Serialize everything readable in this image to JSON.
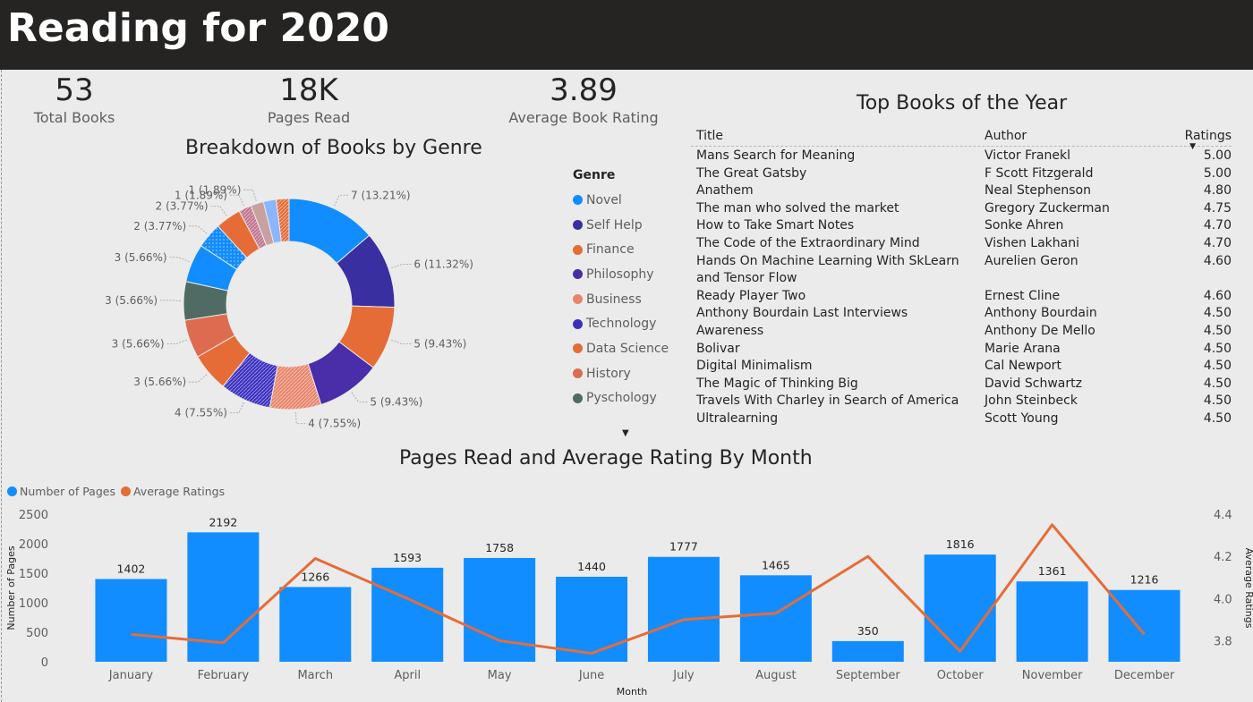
{
  "page": {
    "title": "Reading for 2020"
  },
  "kpis": [
    {
      "value": "53",
      "label": "Total Books"
    },
    {
      "value": "18K",
      "label": "Pages Read"
    },
    {
      "value": "3.89",
      "label": "Average Book Rating"
    }
  ],
  "colors": {
    "header_bg": "#252423",
    "bar": "#118dff",
    "line": "#e66c37",
    "background": "#ebebeb"
  },
  "table": {
    "title": "Top Books of the Year",
    "headers": {
      "title": "Title",
      "author": "Author",
      "ratings": "Ratings"
    },
    "rows": [
      {
        "title": "Mans Search for Meaning",
        "author": "Victor Franekl",
        "rating": "5.00"
      },
      {
        "title": "The Great Gatsby",
        "author": "F Scott Fitzgerald",
        "rating": "5.00"
      },
      {
        "title": "Anathem",
        "author": "Neal Stephenson",
        "rating": "4.80"
      },
      {
        "title": "The man who solved the market",
        "author": "Gregory Zuckerman",
        "rating": "4.75"
      },
      {
        "title": "How to Take Smart Notes",
        "author": "Sonke Ahren",
        "rating": "4.70"
      },
      {
        "title": "The Code of the Extraordinary Mind",
        "author": "Vishen Lakhani",
        "rating": "4.70"
      },
      {
        "title": "Hands On Machine Learning With SkLearn and Tensor Flow",
        "author": "Aurelien Geron",
        "rating": "4.60"
      },
      {
        "title": "Ready Player Two",
        "author": "Ernest Cline",
        "rating": "4.60"
      },
      {
        "title": "Anthony Bourdain Last Interviews",
        "author": "Anthony Bourdain",
        "rating": "4.50"
      },
      {
        "title": "Awareness",
        "author": "Anthony De Mello",
        "rating": "4.50"
      },
      {
        "title": "Bolivar",
        "author": "Marie Arana",
        "rating": "4.50"
      },
      {
        "title": "Digital Minimalism",
        "author": "Cal Newport",
        "rating": "4.50"
      },
      {
        "title": "The Magic of Thinking Big",
        "author": "David Schwartz",
        "rating": "4.50"
      },
      {
        "title": "Travels With Charley in Search of America",
        "author": "John Steinbeck",
        "rating": "4.50"
      },
      {
        "title": "Ultralearning",
        "author": "Scott Young",
        "rating": "4.50"
      }
    ]
  },
  "chart_data": [
    {
      "type": "pie",
      "title": "Breakdown of Books by Genre",
      "legend_title": "Genre",
      "legend_position": "right",
      "donut": true,
      "slices": [
        {
          "value": 7,
          "label": "7 (13.21%)",
          "color": "#118dff",
          "pattern": "solid"
        },
        {
          "value": 6,
          "label": "6 (11.32%)",
          "color": "#3a2fa0",
          "pattern": "solid"
        },
        {
          "value": 5,
          "label": "5 (9.43%)",
          "color": "#e66c37",
          "pattern": "solid"
        },
        {
          "value": 5,
          "label": "5 (9.43%)",
          "color": "#4a2da8",
          "pattern": "solid"
        },
        {
          "value": 4,
          "label": "4 (7.55%)",
          "color": "#e8856b",
          "pattern": "hatch"
        },
        {
          "value": 4,
          "label": "4 (7.55%)",
          "color": "#3a2fc0",
          "pattern": "hatch"
        },
        {
          "value": 3,
          "label": "3 (5.66%)",
          "color": "#e66c37",
          "pattern": "solid"
        },
        {
          "value": 3,
          "label": "3 (5.66%)",
          "color": "#dd6b50",
          "pattern": "solid"
        },
        {
          "value": 3,
          "label": "3 (5.66%)",
          "color": "#4f6b64",
          "pattern": "solid"
        },
        {
          "value": 3,
          "label": "3 (5.66%)",
          "color": "#118dff",
          "pattern": "solid"
        },
        {
          "value": 2,
          "label": "2 (3.77%)",
          "color": "#118dff",
          "pattern": "dots"
        },
        {
          "value": 2,
          "label": "2 (3.77%)",
          "color": "#e66c37",
          "pattern": "solid"
        },
        {
          "value": 1,
          "label": "1 (1.89%)",
          "color": "#c0748e",
          "pattern": "hatch"
        },
        {
          "value": 1,
          "label": "1 (1.89%)",
          "color": "#c8a0a0",
          "pattern": "solid"
        },
        {
          "value": 1,
          "label": "",
          "color": "#8ab6ff",
          "pattern": "solid"
        },
        {
          "value": 1,
          "label": "",
          "color": "#e66c37",
          "pattern": "hatch"
        }
      ],
      "legend": [
        {
          "name": "Novel",
          "color": "#118dff"
        },
        {
          "name": "Self Help",
          "color": "#3a2fa0"
        },
        {
          "name": "Finance",
          "color": "#e66c37"
        },
        {
          "name": "Philosophy",
          "color": "#4a2da8"
        },
        {
          "name": "Business",
          "color": "#e8856b"
        },
        {
          "name": "Technology",
          "color": "#3a2fc0"
        },
        {
          "name": "Data Science",
          "color": "#e66c37"
        },
        {
          "name": "History",
          "color": "#dd6b50"
        },
        {
          "name": "Pyschology",
          "color": "#4f6b64"
        }
      ]
    },
    {
      "type": "bar",
      "title": "Pages Read and Average Rating By Month",
      "categories": [
        "January",
        "February",
        "March",
        "April",
        "May",
        "June",
        "July",
        "August",
        "September",
        "October",
        "November",
        "December"
      ],
      "series": [
        {
          "name": "Number of Pages",
          "type": "bar",
          "axis": "left",
          "color": "#118dff",
          "values": [
            1402,
            2192,
            1266,
            1593,
            1758,
            1440,
            1777,
            1465,
            350,
            1816,
            1361,
            1216
          ]
        },
        {
          "name": "Average Ratings",
          "type": "line",
          "axis": "right",
          "color": "#e66c37",
          "values": [
            3.83,
            3.79,
            4.19,
            4.0,
            3.8,
            3.74,
            3.9,
            3.93,
            4.2,
            3.75,
            4.35,
            3.83
          ]
        }
      ],
      "xlabel": "Month",
      "ylabel": "Number of Pages",
      "y2label": "Average Ratings",
      "ylim": [
        0,
        2500
      ],
      "y2lim": [
        3.7,
        4.4
      ],
      "yticks": [
        "0",
        "500",
        "1000",
        "1500",
        "2000",
        "2500"
      ],
      "y2ticks": [
        "3.8",
        "4.0",
        "4.2",
        "4.4"
      ],
      "legend_position": "top-left",
      "grid": false
    }
  ]
}
